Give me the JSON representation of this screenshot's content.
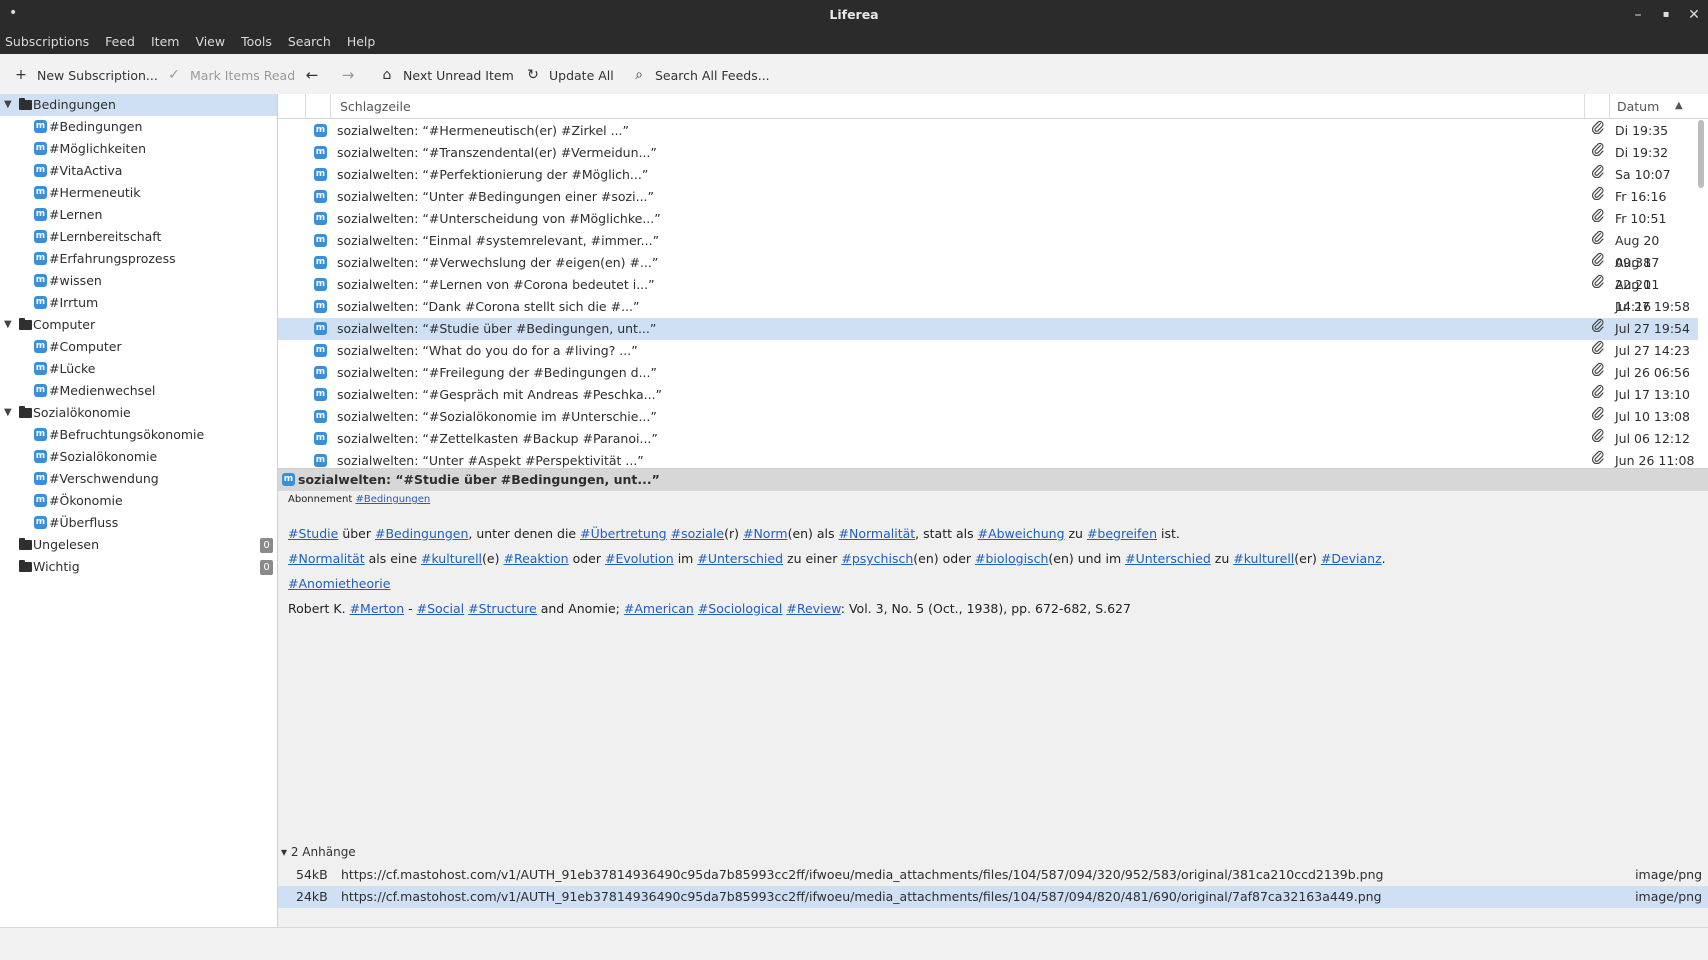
{
  "window": {
    "title": "Liferea",
    "controls": {
      "minimize": "–",
      "maximize": "▪",
      "close": "✕"
    }
  },
  "menu": [
    "Subscriptions",
    "Feed",
    "Item",
    "View",
    "Tools",
    "Search",
    "Help"
  ],
  "toolbar": {
    "new_subscription": "New Subscription...",
    "mark_read": "Mark Items Read",
    "next_unread": "Next Unread Item",
    "update_all": "Update All",
    "search_all": "Search All Feeds..."
  },
  "sidebar": {
    "folders": [
      {
        "name": "Bedingungen",
        "selected": true,
        "feeds": [
          "#Bedingungen",
          "#Möglichkeiten",
          "#VitaActiva",
          "#Hermeneutik",
          "#Lernen",
          "#Lernbereitschaft",
          "#Erfahrungsprozess",
          "#wissen",
          "#Irrtum"
        ]
      },
      {
        "name": "Computer",
        "feeds": [
          "#Computer",
          "#Lücke",
          "#Medienwechsel"
        ]
      },
      {
        "name": "Sozialökonomie",
        "feeds": [
          "#Befruchtungsökonomie",
          "#Sozialökonomie",
          "#Verschwendung",
          "#Ökonomie",
          "#Überfluss"
        ]
      }
    ],
    "special": [
      {
        "name": "Ungelesen",
        "count": "0"
      },
      {
        "name": "Wichtig",
        "count": "0"
      }
    ]
  },
  "item_list": {
    "col_headline": "Schlagzeile",
    "col_date": "Datum",
    "items": [
      {
        "headline": "sozialwelten: “#Hermeneutisch(er) #Zirkel ...”",
        "date": "Di 19:35",
        "attachment": true
      },
      {
        "headline": "sozialwelten: “#Transzendental(er) #Vermeidun...”",
        "date": "Di 19:32",
        "attachment": true
      },
      {
        "headline": "sozialwelten: “#Perfektionierung der #Möglich...”",
        "date": "Sa 10:07",
        "attachment": true
      },
      {
        "headline": "sozialwelten: “Unter #Bedingungen einer #sozi...”",
        "date": "Fr 16:16",
        "attachment": true
      },
      {
        "headline": "sozialwelten: “#Unterscheidung von #Möglichke...”",
        "date": "Fr 10:51",
        "attachment": true
      },
      {
        "headline": "sozialwelten: “Einmal #systemrelevant, #immer...”",
        "date": "Aug 20 09:38",
        "attachment": true
      },
      {
        "headline": "sozialwelten: “#Verwechslung der #eigen(en) #...”",
        "date": "Aug 17 22:20",
        "attachment": true
      },
      {
        "headline": "sozialwelten: “#Lernen von #Corona bedeutet i...”",
        "date": "Aug 11 14:16",
        "attachment": true
      },
      {
        "headline": "sozialwelten: “Dank #Corona stellt sich die #...”",
        "date": "Jul 27 19:58",
        "attachment": false
      },
      {
        "headline": "sozialwelten: “#Studie über #Bedingungen, unt...”",
        "date": "Jul 27 19:54",
        "attachment": true,
        "selected": true
      },
      {
        "headline": "sozialwelten: “What do you do for a #living? ...”",
        "date": "Jul 27 14:23",
        "attachment": true
      },
      {
        "headline": "sozialwelten: “#Freilegung der #Bedingungen d...”",
        "date": "Jul 26 06:56",
        "attachment": true
      },
      {
        "headline": "sozialwelten: “#Gespräch mit Andreas #Peschka...”",
        "date": "Jul 17 13:10",
        "attachment": true
      },
      {
        "headline": "sozialwelten: “#Sozialökonomie im #Unterschie...”",
        "date": "Jul 10 13:08",
        "attachment": true
      },
      {
        "headline": "sozialwelten: “#Zettelkasten #Backup #Paranoi...”",
        "date": "Jul 06 12:12",
        "attachment": true
      },
      {
        "headline": "sozialwelten: “Unter #Aspekt #Perspektivität ...”",
        "date": "Jun 26 11:08",
        "attachment": true
      }
    ]
  },
  "preview": {
    "title": "sozialwelten: “#Studie über #Bedingungen, unt...”",
    "subscription_label": "Abonnement",
    "subscription_link": "#Bedingungen",
    "paragraphs": [
      [
        {
          "t": "#Studie",
          "l": true
        },
        {
          "t": " über "
        },
        {
          "t": "#Bedingungen",
          "l": true
        },
        {
          "t": ", unter denen die "
        },
        {
          "t": "#Übertretung",
          "l": true
        },
        {
          "t": " "
        },
        {
          "t": "#soziale",
          "l": true
        },
        {
          "t": "(r) "
        },
        {
          "t": "#Norm",
          "l": true
        },
        {
          "t": "(en) als "
        },
        {
          "t": "#Normalität",
          "l": true
        },
        {
          "t": ", statt als "
        },
        {
          "t": "#Abweichung",
          "l": true
        },
        {
          "t": " zu "
        },
        {
          "t": "#begreifen",
          "l": true
        },
        {
          "t": " ist."
        }
      ],
      [
        {
          "t": "#Normalität",
          "l": true
        },
        {
          "t": " als eine "
        },
        {
          "t": "#kulturell",
          "l": true
        },
        {
          "t": "(e) "
        },
        {
          "t": "#Reaktion",
          "l": true
        },
        {
          "t": " oder "
        },
        {
          "t": "#Evolution",
          "l": true
        },
        {
          "t": " im "
        },
        {
          "t": "#Unterschied",
          "l": true
        },
        {
          "t": " zu einer "
        },
        {
          "t": "#psychisch",
          "l": true
        },
        {
          "t": "(en) oder "
        },
        {
          "t": "#biologisch",
          "l": true
        },
        {
          "t": "(en) und im "
        },
        {
          "t": "#Unterschied",
          "l": true
        },
        {
          "t": " zu "
        },
        {
          "t": "#kulturell",
          "l": true
        },
        {
          "t": "(er) "
        },
        {
          "t": "#Devianz",
          "l": true
        },
        {
          "t": "."
        }
      ],
      [
        {
          "t": "#Anomietheorie",
          "l": true
        }
      ],
      [
        {
          "t": "Robert K. "
        },
        {
          "t": "#Merton",
          "l": true
        },
        {
          "t": " - "
        },
        {
          "t": "#Social",
          "l": true
        },
        {
          "t": " "
        },
        {
          "t": "#Structure",
          "l": true
        },
        {
          "t": " and Anomie; "
        },
        {
          "t": "#American",
          "l": true
        },
        {
          "t": " "
        },
        {
          "t": "#Sociological",
          "l": true
        },
        {
          "t": " "
        },
        {
          "t": "#Review",
          "l": true
        },
        {
          "t": ": Vol. 3, No. 5 (Oct., 1938), pp. 672-682, S.627"
        }
      ]
    ],
    "attachments_label": "2 Anhänge",
    "attachments": [
      {
        "size": "54kB",
        "url": "https://cf.mastohost.com/v1/AUTH_91eb37814936490c95da7b85993cc2ff/ifwoeu/media_attachments/files/104/587/094/320/952/583/original/381ca210ccd2139b.png",
        "mime": "image/png"
      },
      {
        "size": "24kB",
        "url": "https://cf.mastohost.com/v1/AUTH_91eb37814936490c95da7b85993cc2ff/ifwoeu/media_attachments/files/104/587/094/820/481/690/original/7af87ca32163a449.png",
        "mime": "image/png",
        "selected": true
      }
    ]
  },
  "icons": {
    "add": "+",
    "check": "✓",
    "back": "←",
    "forward": "→",
    "next_unread": "⌂",
    "refresh": "↻",
    "search": "⌕",
    "folder": "folder-icon",
    "mastodon": "m",
    "clip": "⌀"
  }
}
